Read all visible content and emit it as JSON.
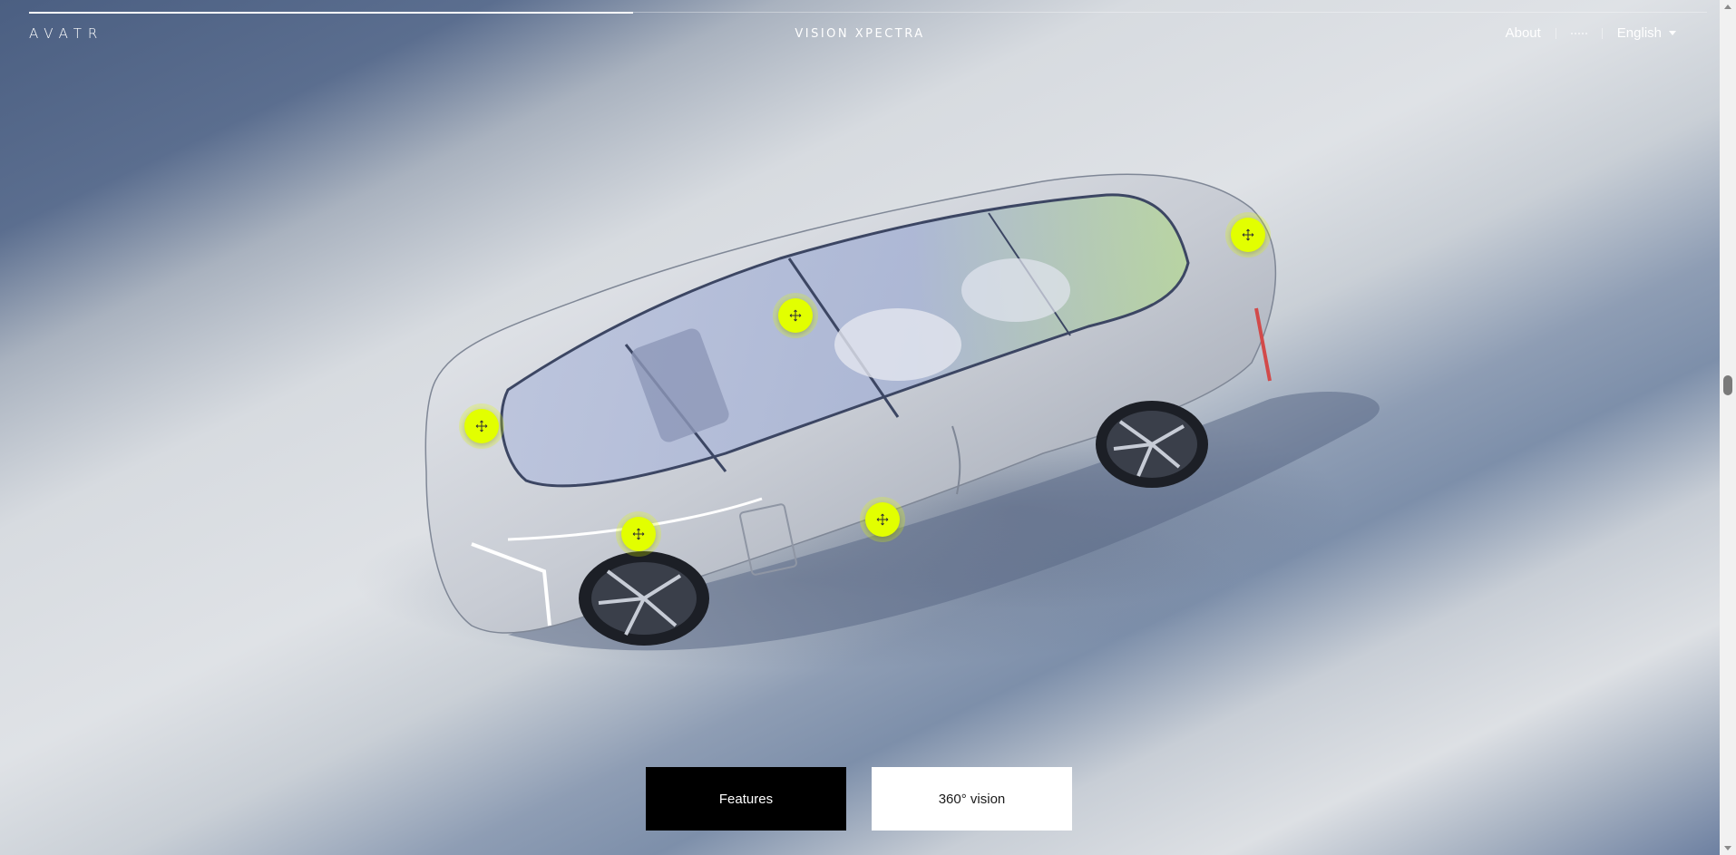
{
  "header": {
    "logo": "AVATR",
    "title": "VISION XPECTRA",
    "nav": {
      "about_label": "About",
      "language_label": "English"
    },
    "progress_fraction": 0.36
  },
  "hotspots": [
    {
      "name": "hotspot-roof",
      "icon": "move-cross-icon"
    },
    {
      "name": "hotspot-rear",
      "icon": "move-cross-icon"
    },
    {
      "name": "hotspot-front",
      "icon": "move-cross-icon"
    },
    {
      "name": "hotspot-front-wheel",
      "icon": "move-cross-icon"
    },
    {
      "name": "hotspot-door",
      "icon": "move-cross-icon"
    }
  ],
  "buttons": {
    "features_label": "Features",
    "vision_label": "360° vision"
  },
  "colors": {
    "hotspot": "#e2ff00",
    "primary_button": "#000000",
    "secondary_button": "#ffffff"
  }
}
